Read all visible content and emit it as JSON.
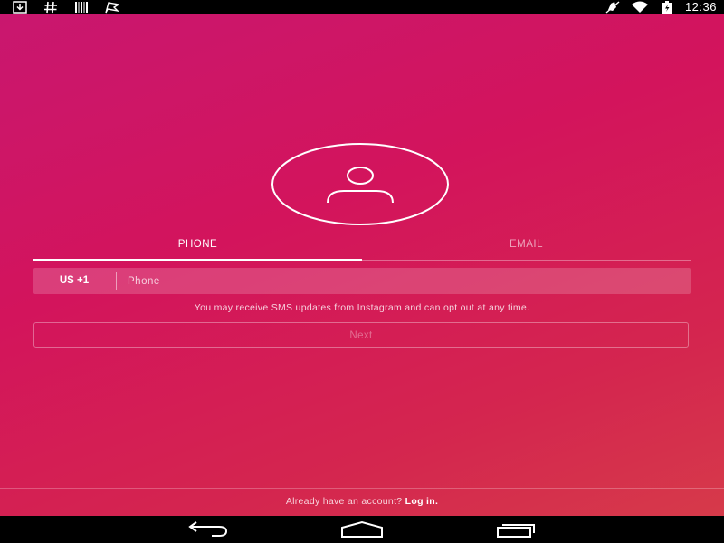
{
  "status_bar": {
    "left_icons": [
      "download-icon",
      "hash-icon",
      "barcode-icon",
      "flag-icon"
    ],
    "right_icons": [
      "mute-icon",
      "wifi-icon",
      "battery-icon"
    ],
    "time": "12:36"
  },
  "signup": {
    "avatar_icon": "user-icon",
    "tabs": [
      {
        "label": "PHONE",
        "active": true
      },
      {
        "label": "EMAIL",
        "active": false
      }
    ],
    "country_code": "US +1",
    "phone_placeholder": "Phone",
    "sms_note": "You may receive SMS updates from Instagram and can opt out at any time.",
    "next_label": "Next"
  },
  "footer": {
    "prompt": "Already have an account?",
    "login_label": "Log in."
  },
  "nav_bar": {
    "buttons": [
      "back-icon",
      "home-icon",
      "recents-icon"
    ]
  },
  "colors": {
    "gradient_start": "#c9176f",
    "gradient_mid": "#d3145c",
    "gradient_end": "#d63a4a",
    "text": "#ffffff",
    "system_bar": "#000000"
  }
}
